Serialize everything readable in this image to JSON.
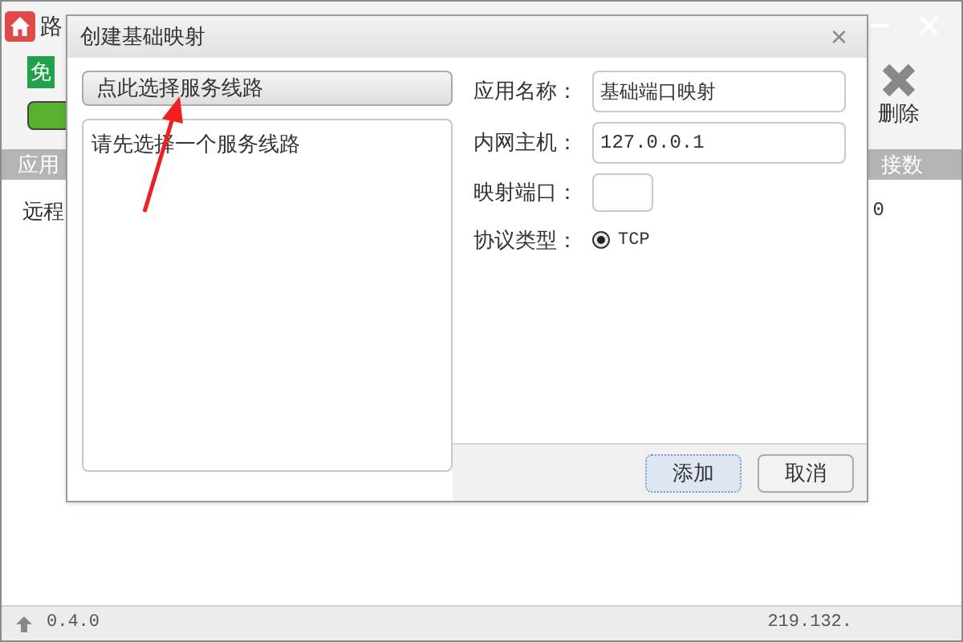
{
  "main_window": {
    "title": "路",
    "toolbar": {
      "badge": "免",
      "delete_label": "删除"
    },
    "table": {
      "columns": [
        "应用",
        "接数"
      ],
      "rows": [
        {
          "cells": [
            "远程",
            "0"
          ]
        }
      ]
    },
    "status_bar": {
      "version": "0.4.0",
      "address": "219.132."
    }
  },
  "dialog": {
    "title": "创建基础映射",
    "close": "×",
    "select_button": "点此选择服务线路",
    "list_hint": "请先选择一个服务线路",
    "fields": [
      {
        "label": "应用名称：",
        "value": "基础端口映射",
        "kind": "wide"
      },
      {
        "label": "内网主机：",
        "value": "127.0.0.1",
        "kind": "wide"
      },
      {
        "label": "映射端口：",
        "kind": "narrow"
      }
    ],
    "protocol": {
      "label": "协议类型：",
      "options": [
        {
          "label": "TCP",
          "selected": true
        }
      ]
    },
    "buttons": [
      {
        "label": "添加",
        "kind": "default"
      },
      {
        "label": "取消",
        "kind": "normal"
      }
    ]
  }
}
